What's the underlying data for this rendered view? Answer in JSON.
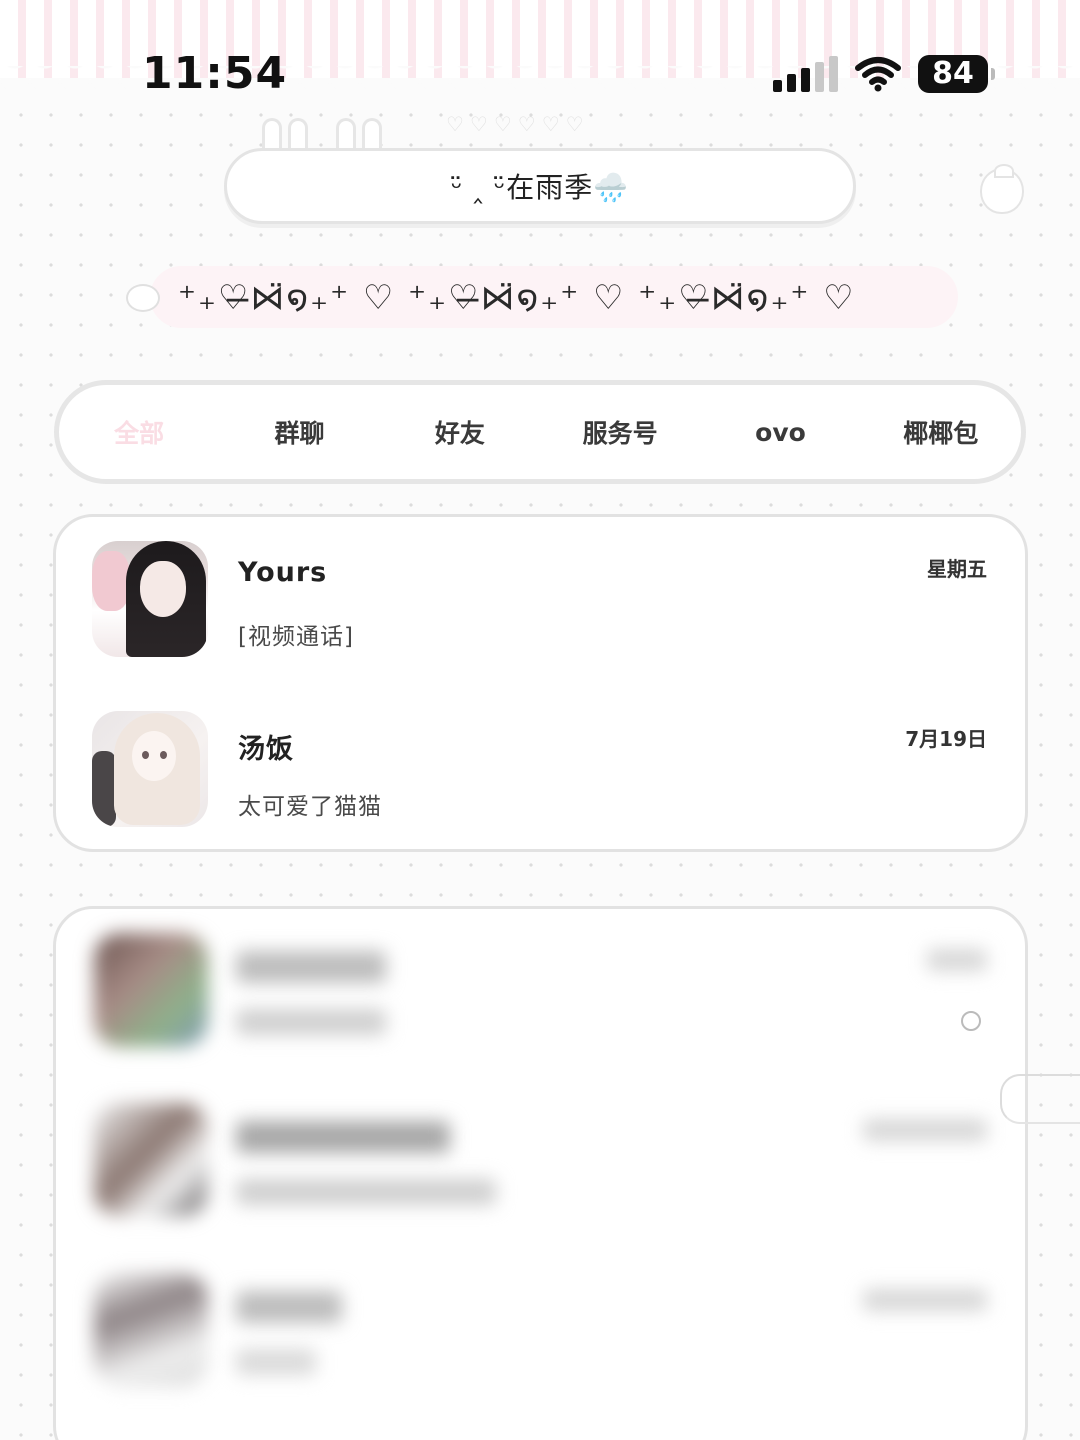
{
  "status_bar": {
    "time": "11:54",
    "battery": "84",
    "wifi_icon": "wifi-icon",
    "signal_icon": "cellular-signal-icon"
  },
  "header": {
    "title": "ᵕ̈ ‸ ᵕ̈在雨季🌧️",
    "decor_hearts": "♡♡♡♡♡♡",
    "decor_strip": "⁺₊♡̶⋈̈໑₊⁺ ♡ ⁺₊♡̶⋈̈໑₊⁺ ♡ ⁺₊♡̶⋈̈໑₊⁺ ♡"
  },
  "tabs": [
    {
      "label": "全部",
      "active": true
    },
    {
      "label": "群聊",
      "active": false
    },
    {
      "label": "好友",
      "active": false
    },
    {
      "label": "服务号",
      "active": false
    },
    {
      "label": "ovo",
      "active": false
    },
    {
      "label": "椰椰包",
      "active": false
    }
  ],
  "pinned_chats": [
    {
      "name": "Yours",
      "message": "[视频通话]",
      "time": "星期五"
    },
    {
      "name": "汤饭",
      "message": "太可爱了猫猫",
      "time": "7月19日"
    }
  ],
  "colors": {
    "active_tab": "#fadde4",
    "stripe_pink": "#fbe9ee",
    "border_grey": "#e4e4e4"
  }
}
